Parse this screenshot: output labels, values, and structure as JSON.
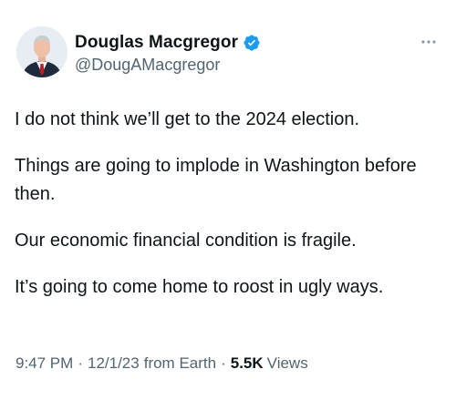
{
  "author": {
    "display_name": "Douglas Macgregor",
    "handle": "@DougAMacgregor",
    "verified": true,
    "verified_color": "#1d9bf0"
  },
  "more_icon": "more-horizontal-icon",
  "tweet": {
    "paragraphs": [
      "I do not think we’ll get to the 2024 election.",
      "Things are going to implode in Washington before then.",
      "Our economic financial condition is fragile.",
      "It’s going to come home to roost in ugly ways."
    ]
  },
  "meta": {
    "time": "9:47 PM",
    "date": "12/1/23",
    "source": "from Earth",
    "separator": "·",
    "views_count": "5.5K",
    "views_label": "Views"
  }
}
